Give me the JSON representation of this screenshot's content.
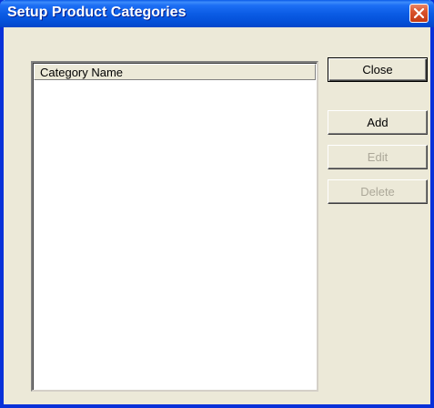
{
  "window": {
    "title": "Setup Product Categories"
  },
  "list": {
    "columns": [
      "Category Name"
    ],
    "rows": []
  },
  "buttons": {
    "close_label": "Close",
    "add_label": "Add",
    "edit_label": "Edit",
    "delete_label": "Delete"
  },
  "states": {
    "edit_enabled": false,
    "delete_enabled": false
  },
  "colors": {
    "titlebar": "#0b5ce5",
    "window_bg": "#ece9d8",
    "close_button": "#d9532c",
    "disabled_text": "#aca899"
  }
}
